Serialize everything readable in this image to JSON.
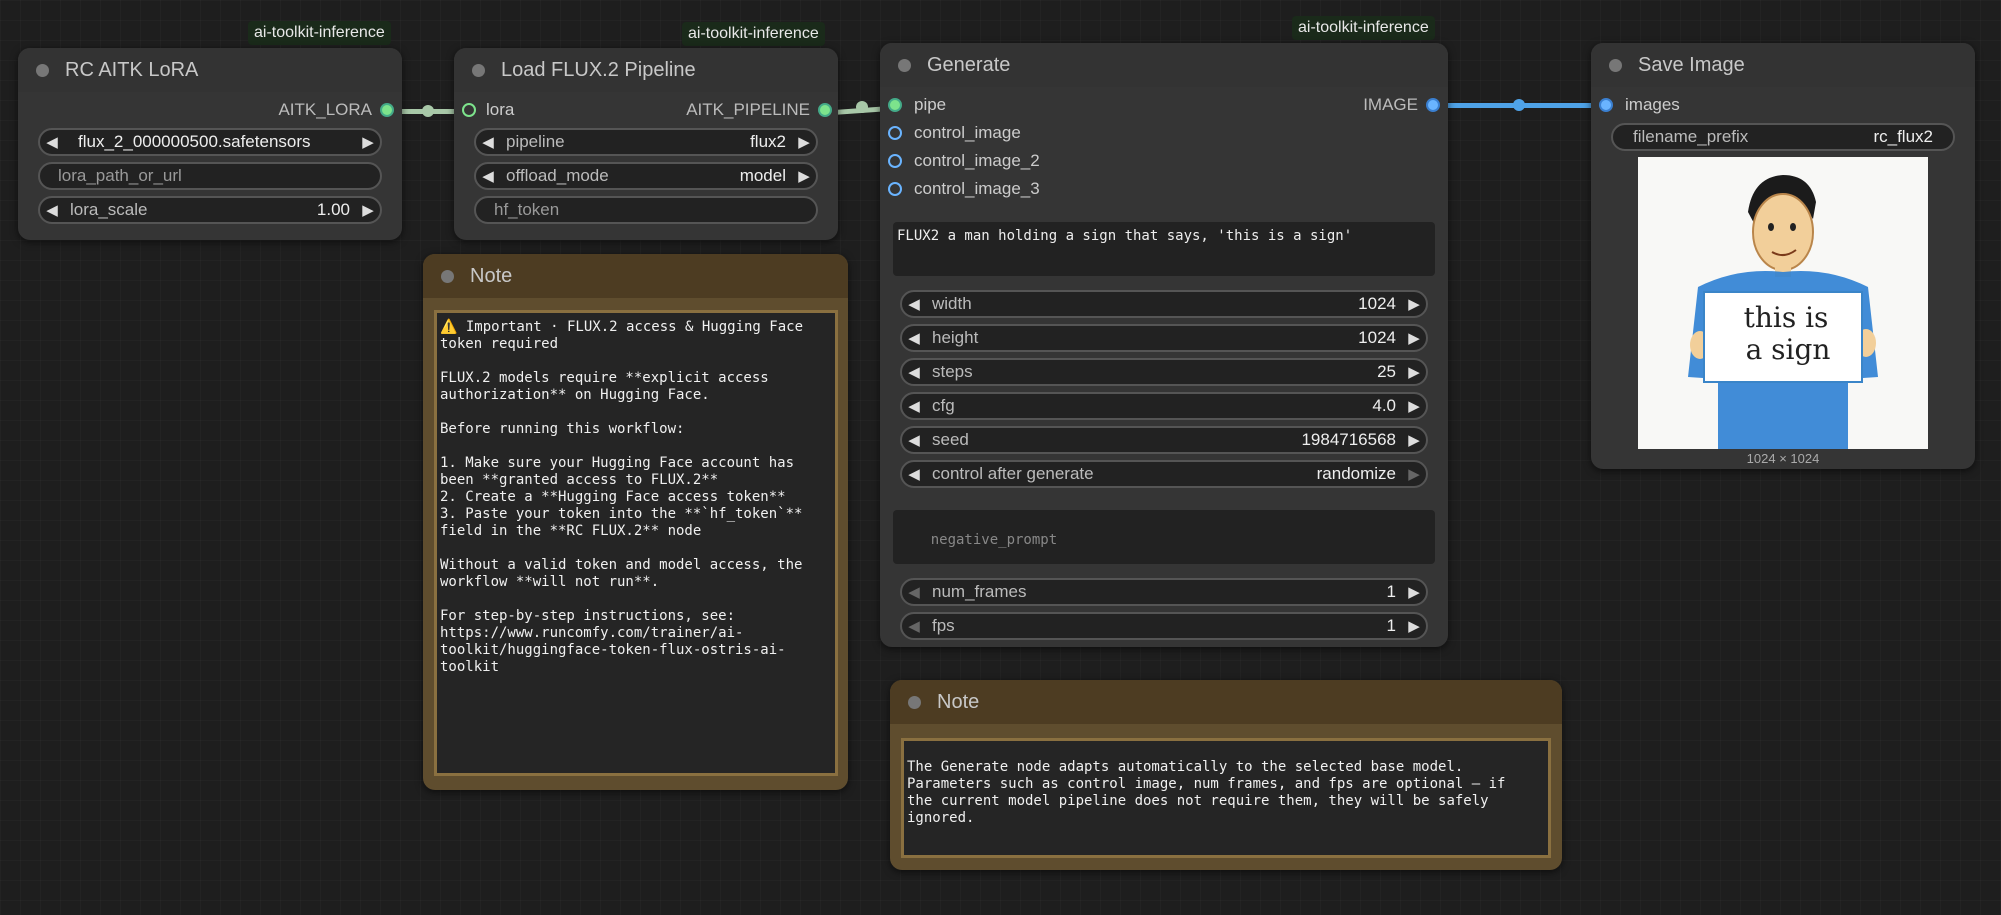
{
  "badges": {
    "lora": "ai-toolkit-inference",
    "pipeline": "ai-toolkit-inference",
    "generate": "ai-toolkit-inference"
  },
  "lora_node": {
    "title": "RC AITK LoRA",
    "output": "AITK_LORA",
    "lora_file": "flux_2_000000500.safetensors",
    "lora_path_placeholder": "lora_path_or_url",
    "lora_scale_label": "lora_scale",
    "lora_scale_value": "1.00"
  },
  "pipeline_node": {
    "title": "Load FLUX.2 Pipeline",
    "input": "lora",
    "output": "AITK_PIPELINE",
    "pipeline_label": "pipeline",
    "pipeline_value": "flux2",
    "offload_label": "offload_mode",
    "offload_value": "model",
    "hf_token_placeholder": "hf_token"
  },
  "generate_node": {
    "title": "Generate",
    "inputs": [
      "pipe",
      "control_image",
      "control_image_2",
      "control_image_3"
    ],
    "output": "IMAGE",
    "prompt": "FLUX2 a man holding a sign that says, 'this is a sign'",
    "widgets": [
      {
        "label": "width",
        "value": "1024"
      },
      {
        "label": "height",
        "value": "1024"
      },
      {
        "label": "steps",
        "value": "25"
      },
      {
        "label": "cfg",
        "value": "4.0"
      },
      {
        "label": "seed",
        "value": "1984716568"
      },
      {
        "label": "control after generate",
        "value": "randomize"
      }
    ],
    "negative_prompt_placeholder": "negative_prompt",
    "extra_widgets": [
      {
        "label": "num_frames",
        "value": "1"
      },
      {
        "label": "fps",
        "value": "1"
      }
    ]
  },
  "save_node": {
    "title": "Save Image",
    "input": "images",
    "filename_label": "filename_prefix",
    "filename_value": "rc_flux2",
    "image_size": "1024 × 1024",
    "sign_text_line1": "this is",
    "sign_text_line2": "a sign"
  },
  "note1": {
    "title": "Note",
    "body": "⚠️ Important · FLUX.2 access & Hugging Face\ntoken required\n\nFLUX.2 models require **explicit access\nauthorization** on Hugging Face.\n\nBefore running this workflow:\n\n1. Make sure your Hugging Face account has\nbeen **granted access to FLUX.2**\n2. Create a **Hugging Face access token**\n3. Paste your token into the **`hf_token`**\nfield in the **RC FLUX.2** node\n\nWithout a valid token and model access, the\nworkflow **will not run**.\n\nFor step-by-step instructions, see:\nhttps://www.runcomfy.com/trainer/ai-\ntoolkit/huggingface-token-flux-ostris-ai-\ntoolkit"
  },
  "note2": {
    "title": "Note",
    "body": "The Generate node adapts automatically to the selected base model.\nParameters such as control image, num frames, and fps are optional — if\nthe current model pipeline does not require them, they will be safely\nignored."
  },
  "colors": {
    "link_green": "#a8c8a8",
    "link_blue": "#4fa3e8",
    "note_bg": "#5f4d2e"
  }
}
